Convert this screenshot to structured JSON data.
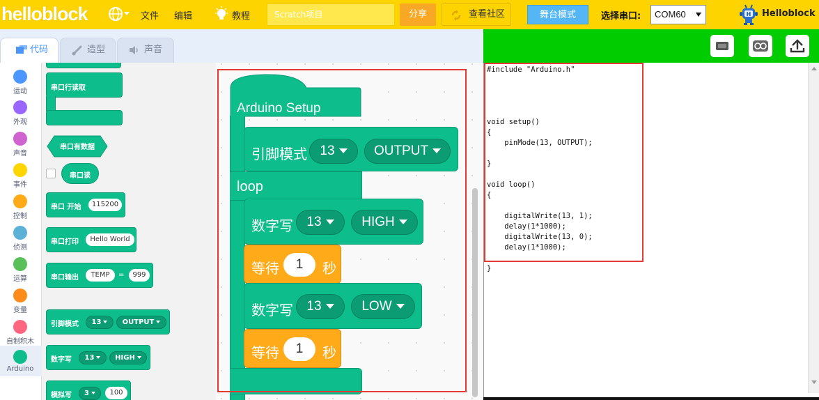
{
  "header": {
    "logo": "helloblock",
    "menu_file": "文件",
    "menu_edit": "编辑",
    "tutorial": "教程",
    "project_title": "Scratch项目",
    "share": "分享",
    "community": "查看社区",
    "stage_mode": "舞台模式",
    "port_label": "选择串口:",
    "port_value": "COM60",
    "user_name": "Helloblock"
  },
  "tabs": [
    {
      "label": "代码",
      "icon": "code-icon"
    },
    {
      "label": "造型",
      "icon": "brush-icon"
    },
    {
      "label": "声音",
      "icon": "speaker-icon"
    }
  ],
  "categories": [
    {
      "label": "运动",
      "color": "#4c97ff"
    },
    {
      "label": "外观",
      "color": "#9966ff"
    },
    {
      "label": "声音",
      "color": "#cf63cf"
    },
    {
      "label": "事件",
      "color": "#ffd500"
    },
    {
      "label": "控制",
      "color": "#ffab19"
    },
    {
      "label": "侦测",
      "color": "#5cb1d6"
    },
    {
      "label": "运算",
      "color": "#59c059"
    },
    {
      "label": "变量",
      "color": "#ff8c1a"
    },
    {
      "label": "自制积木",
      "color": "#ff6680"
    },
    {
      "label": "Arduino",
      "color": "#0fbd8c"
    }
  ],
  "palette": {
    "serial_readline": "串口行读取",
    "serial_available": "串口有数据",
    "serial_read": "串口读",
    "serial_begin": "串口 开始",
    "serial_begin_value": "115200",
    "serial_print": "串口打印",
    "serial_print_value": "Hello World",
    "serial_output": "串口输出",
    "serial_output_key": "TEMP",
    "serial_output_eq": "=",
    "serial_output_value": "999",
    "pin_mode": "引脚模式",
    "pin_mode_pin": "13",
    "pin_mode_mode": "OUTPUT",
    "digital_write": "数字写",
    "digital_write_pin": "13",
    "digital_write_value": "HIGH",
    "analog_write": "模拟写",
    "analog_write_pin": "3",
    "analog_write_value": "100"
  },
  "workspace": {
    "setup_label": "Arduino Setup",
    "pin_mode_label": "引脚模式",
    "pin_mode_pin": "13",
    "pin_mode_mode": "OUTPUT",
    "loop_label": "loop",
    "dw1_label": "数字写",
    "dw1_pin": "13",
    "dw1_value": "HIGH",
    "wait1_label": "等待",
    "wait1_value": "1",
    "wait1_unit": "秒",
    "dw2_label": "数字写",
    "dw2_pin": "13",
    "dw2_value": "LOW",
    "wait2_label": "等待",
    "wait2_value": "1",
    "wait2_unit": "秒"
  },
  "code": {
    "text": "#include \"Arduino.h\"\n\n\n\n\nvoid setup()\n{\n    pinMode(13, OUTPUT);\n\n}\n\nvoid loop()\n{\n\n    digitalWrite(13, 1);\n    delay(1*1000);\n    digitalWrite(13, 0);\n    delay(1*1000);\n\n}"
  },
  "colors": {
    "header_bg": "#fdd400",
    "arduino_green": "#0fbd8c",
    "control_orange": "#ffab19",
    "right_bar_green": "#00cc00",
    "highlight_red": "#e53935"
  }
}
